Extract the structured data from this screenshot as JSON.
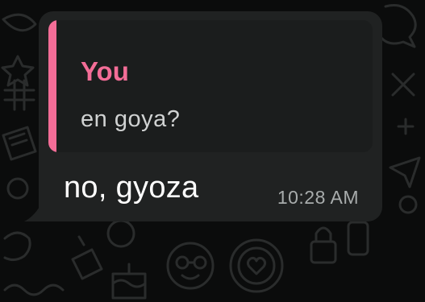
{
  "chat": {
    "message": {
      "text": "no, gyoza",
      "timestamp": "10:28 AM"
    },
    "quoted_reply": {
      "author": "You",
      "text": "en goya?"
    }
  },
  "colors": {
    "background": "#0b0c0c",
    "bubble": "#202222",
    "quote_background": "#1b1d1d",
    "accent": "#f36d97",
    "message_text": "#ffffff",
    "quote_text": "#d0d2d2",
    "timestamp": "#a8acac",
    "wallpaper_doodles": "#2a2c2c"
  }
}
